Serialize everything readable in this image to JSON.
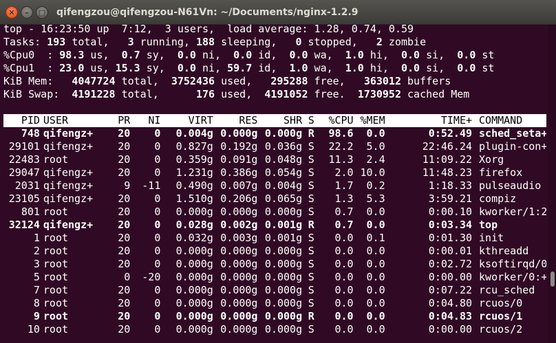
{
  "window": {
    "title": "qifengzou@qifengzou-N61Vn: ~/Documents/nginx-1.2.9",
    "close_glyph": "✕",
    "min_glyph": "–",
    "max_glyph": "□"
  },
  "summary": [
    [
      {
        "t": "top - 16:23:50 up  7:12,  3 users,  load average: 1.28, 0.74, 0.59"
      }
    ],
    [
      {
        "t": "Tasks: "
      },
      {
        "t": "193",
        "b": 1
      },
      {
        "t": " total,   "
      },
      {
        "t": "3",
        "b": 1
      },
      {
        "t": " running, "
      },
      {
        "t": "188",
        "b": 1
      },
      {
        "t": " sleeping,   "
      },
      {
        "t": "0",
        "b": 1
      },
      {
        "t": " stopped,   "
      },
      {
        "t": "2",
        "b": 1
      },
      {
        "t": " zombie"
      }
    ],
    [
      {
        "t": "%Cpu0  : "
      },
      {
        "t": "98.3",
        "b": 1
      },
      {
        "t": " us,  "
      },
      {
        "t": "0.7",
        "b": 1
      },
      {
        "t": " sy,  "
      },
      {
        "t": "0.0",
        "b": 1
      },
      {
        "t": " ni,  "
      },
      {
        "t": "0.0",
        "b": 1
      },
      {
        "t": " id,  "
      },
      {
        "t": "0.0",
        "b": 1
      },
      {
        "t": " wa,  "
      },
      {
        "t": "1.0",
        "b": 1
      },
      {
        "t": " hi,  "
      },
      {
        "t": "0.0",
        "b": 1
      },
      {
        "t": " si,  "
      },
      {
        "t": "0.0",
        "b": 1
      },
      {
        "t": " st"
      }
    ],
    [
      {
        "t": "%Cpu1  : "
      },
      {
        "t": "23.0",
        "b": 1
      },
      {
        "t": " us, "
      },
      {
        "t": "15.3",
        "b": 1
      },
      {
        "t": " sy,  "
      },
      {
        "t": "0.0",
        "b": 1
      },
      {
        "t": " ni, "
      },
      {
        "t": "59.7",
        "b": 1
      },
      {
        "t": " id,  "
      },
      {
        "t": "1.0",
        "b": 1
      },
      {
        "t": " wa,  "
      },
      {
        "t": "1.0",
        "b": 1
      },
      {
        "t": " hi,  "
      },
      {
        "t": "0.0",
        "b": 1
      },
      {
        "t": " si,  "
      },
      {
        "t": "0.0",
        "b": 1
      },
      {
        "t": " st"
      }
    ],
    [
      {
        "t": "KiB Mem:   "
      },
      {
        "t": "4047724",
        "b": 1
      },
      {
        "t": " total,  "
      },
      {
        "t": "3752436",
        "b": 1
      },
      {
        "t": " used,   "
      },
      {
        "t": "295288",
        "b": 1
      },
      {
        "t": " free,   "
      },
      {
        "t": "363012",
        "b": 1
      },
      {
        "t": " buffers"
      }
    ],
    [
      {
        "t": "KiB Swap:  "
      },
      {
        "t": "4191228",
        "b": 1
      },
      {
        "t": " total,      "
      },
      {
        "t": "176",
        "b": 1
      },
      {
        "t": " used,  "
      },
      {
        "t": "4191052",
        "b": 1
      },
      {
        "t": " free.  "
      },
      {
        "t": "1730952",
        "b": 1
      },
      {
        "t": " cached Mem"
      }
    ]
  ],
  "table": {
    "columns": [
      "PID",
      "USER",
      "PR",
      "NI",
      "VIRT",
      "RES",
      "SHR",
      "S",
      "%CPU",
      "%MEM",
      "TIME+",
      "COMMAND"
    ],
    "rows": [
      {
        "bold": true,
        "cells": [
          "748",
          "qifengz+",
          "20",
          "0",
          "0.004g",
          "0.000g",
          "0.000g",
          "R",
          "98.6",
          "0.0",
          "0:52.49",
          "sched_seta+"
        ]
      },
      {
        "bold": false,
        "cells": [
          "29101",
          "qifengz+",
          "20",
          "0",
          "0.827g",
          "0.192g",
          "0.036g",
          "S",
          "22.2",
          "5.0",
          "22:46.24",
          "plugin-con+"
        ]
      },
      {
        "bold": false,
        "cells": [
          "22483",
          "root",
          "20",
          "0",
          "0.359g",
          "0.091g",
          "0.048g",
          "S",
          "11.3",
          "2.4",
          "11:09.22",
          "Xorg"
        ]
      },
      {
        "bold": false,
        "cells": [
          "29047",
          "qifengz+",
          "20",
          "0",
          "1.231g",
          "0.386g",
          "0.054g",
          "S",
          "2.0",
          "10.0",
          "11:48.23",
          "firefox"
        ]
      },
      {
        "bold": false,
        "cells": [
          "2031",
          "qifengz+",
          "9",
          "-11",
          "0.490g",
          "0.007g",
          "0.004g",
          "S",
          "1.7",
          "0.2",
          "1:18.33",
          "pulseaudio"
        ]
      },
      {
        "bold": false,
        "cells": [
          "23105",
          "qifengz+",
          "20",
          "0",
          "1.510g",
          "0.206g",
          "0.065g",
          "S",
          "1.3",
          "5.3",
          "3:59.21",
          "compiz"
        ]
      },
      {
        "bold": false,
        "cells": [
          "801",
          "root",
          "20",
          "0",
          "0.000g",
          "0.000g",
          "0.000g",
          "S",
          "0.7",
          "0.0",
          "0:00.10",
          "kworker/1:2"
        ]
      },
      {
        "bold": true,
        "cells": [
          "32124",
          "qifengz+",
          "20",
          "0",
          "0.028g",
          "0.002g",
          "0.001g",
          "R",
          "0.7",
          "0.0",
          "0:03.34",
          "top"
        ]
      },
      {
        "bold": false,
        "cells": [
          "1",
          "root",
          "20",
          "0",
          "0.032g",
          "0.003g",
          "0.001g",
          "S",
          "0.0",
          "0.1",
          "0:01.30",
          "init"
        ]
      },
      {
        "bold": false,
        "cells": [
          "2",
          "root",
          "20",
          "0",
          "0.000g",
          "0.000g",
          "0.000g",
          "S",
          "0.0",
          "0.0",
          "0:00.01",
          "kthreadd"
        ]
      },
      {
        "bold": false,
        "cells": [
          "3",
          "root",
          "20",
          "0",
          "0.000g",
          "0.000g",
          "0.000g",
          "S",
          "0.0",
          "0.0",
          "0:02.72",
          "ksoftirqd/0"
        ]
      },
      {
        "bold": false,
        "cells": [
          "5",
          "root",
          "0",
          "-20",
          "0.000g",
          "0.000g",
          "0.000g",
          "S",
          "0.0",
          "0.0",
          "0:00.00",
          "kworker/0:+"
        ]
      },
      {
        "bold": false,
        "cells": [
          "7",
          "root",
          "20",
          "0",
          "0.000g",
          "0.000g",
          "0.000g",
          "S",
          "0.0",
          "0.0",
          "0:07.22",
          "rcu_sched"
        ]
      },
      {
        "bold": false,
        "cells": [
          "8",
          "root",
          "20",
          "0",
          "0.000g",
          "0.000g",
          "0.000g",
          "S",
          "0.0",
          "0.0",
          "0:04.80",
          "rcuos/0"
        ]
      },
      {
        "bold": true,
        "cells": [
          "9",
          "root",
          "20",
          "0",
          "0.000g",
          "0.000g",
          "0.000g",
          "R",
          "0.0",
          "0.0",
          "0:04.83",
          "rcuos/1"
        ]
      },
      {
        "bold": false,
        "cells": [
          "10",
          "root",
          "20",
          "0",
          "0.000g",
          "0.000g",
          "0.000g",
          "S",
          "0.0",
          "0.0",
          "0:00.00",
          "rcuos/2"
        ]
      }
    ]
  },
  "colors": {
    "background": "#300a24",
    "foreground": "#ffffff",
    "header_bg": "#ffffff",
    "header_fg": "#000000",
    "close_button": "#df4a16"
  },
  "icons": [
    "close-icon",
    "minimize-icon",
    "maximize-icon"
  ]
}
